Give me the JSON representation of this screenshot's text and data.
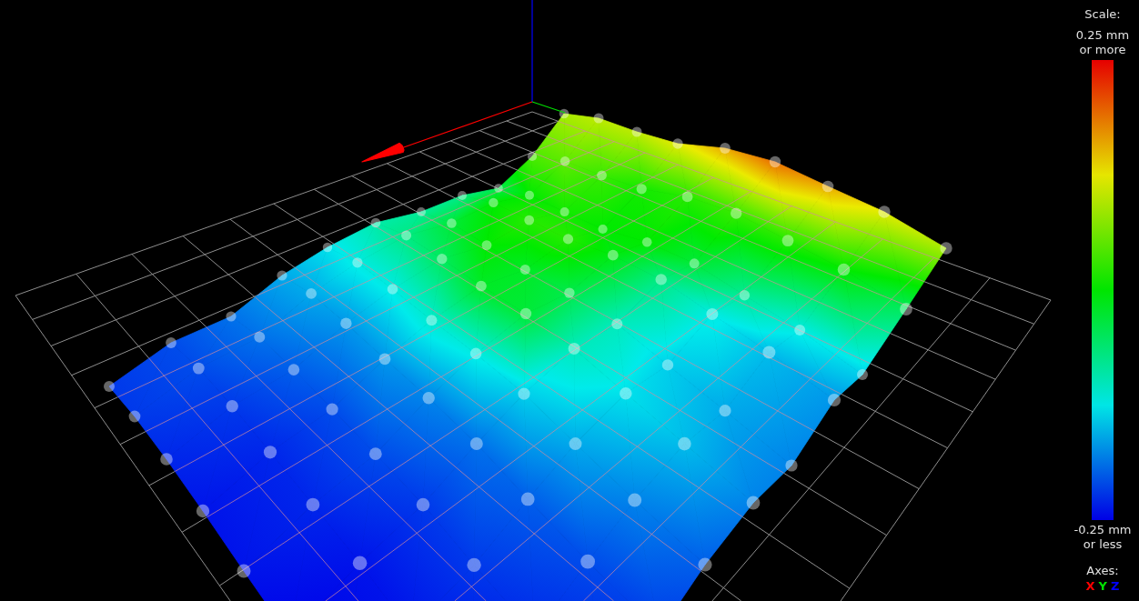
{
  "scale": {
    "title": "Scale:",
    "max_label": "0.25 mm or more",
    "min_label": "-0.25 mm or less"
  },
  "axes": {
    "title": "Axes:",
    "items": [
      {
        "label": "X",
        "color": "#ff0000"
      },
      {
        "label": "Y",
        "color": "#00e000"
      },
      {
        "label": "Z",
        "color": "#0000ff"
      }
    ]
  }
}
